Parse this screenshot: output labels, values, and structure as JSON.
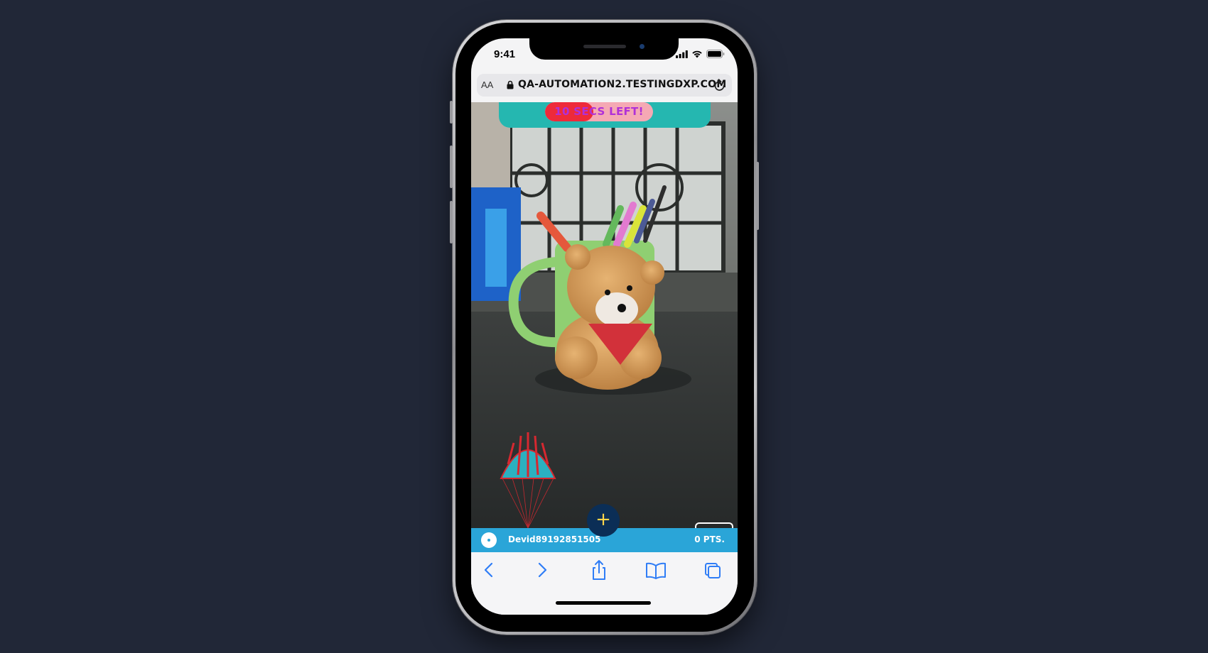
{
  "status_bar": {
    "time": "9:41"
  },
  "browser": {
    "text_size_label": "AA",
    "url": "QA-AUTOMATION2.TESTINGDXP.COM"
  },
  "game": {
    "timer_text": "10 SECS LEFT!",
    "timer_progress": 0.45,
    "add_button_label": "+",
    "username": "Devid89192851505",
    "points": "0 PTS."
  },
  "colors": {
    "page_background": "#212737",
    "timer_banner": "#25b7b0",
    "timer_fill": "#ee2a3a",
    "timer_pill": "#f5a9b4",
    "timer_text": "#b030d8",
    "user_bar": "#2aa5d8",
    "add_button": "#0b2e56",
    "safari_blue": "#2f7df6"
  },
  "icons": {
    "lock": "lock-icon",
    "reload": "reload-icon",
    "back": "chevron-left-icon",
    "forward": "chevron-right-icon",
    "share": "share-icon",
    "bookmarks": "book-icon",
    "tabs": "tabs-icon"
  }
}
